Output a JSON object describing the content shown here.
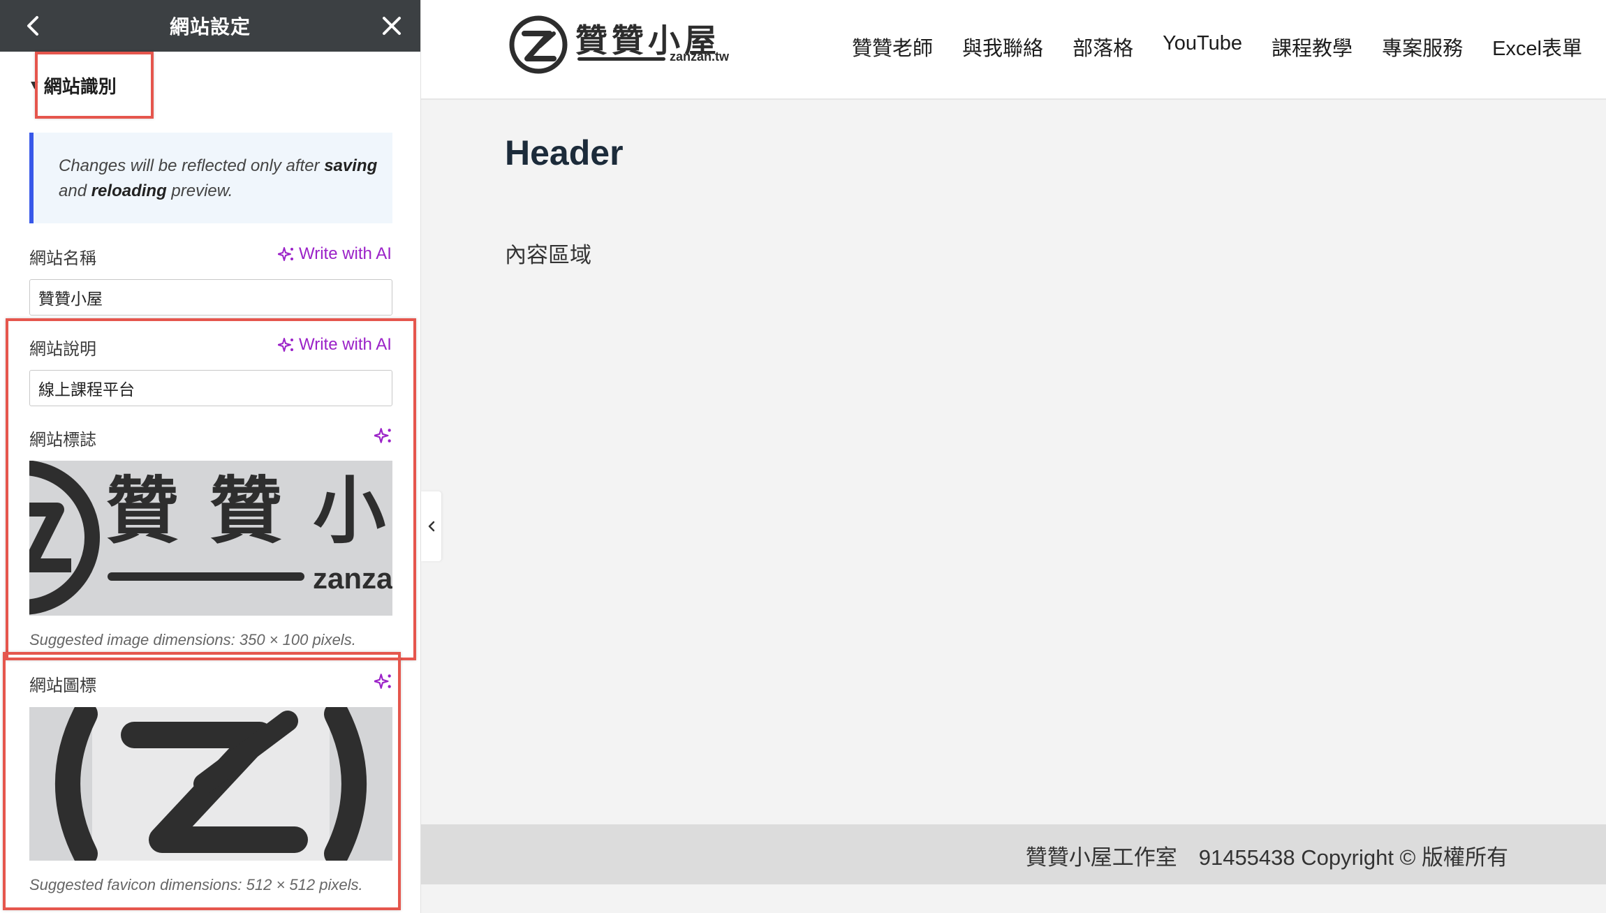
{
  "panel": {
    "title": "網站設定",
    "section_label": "網站識別",
    "notice": {
      "part1": "Changes will be reflected only after ",
      "bold1": "saving",
      "part2": " and ",
      "bold2": "reloading",
      "part3": " preview."
    },
    "ai_label": "Write with AI",
    "fields": {
      "site_title": {
        "label": "網站名稱",
        "value": "贊贊小屋"
      },
      "tagline": {
        "label": "網站說明",
        "value": "線上課程平台"
      },
      "logo": {
        "label": "網站標誌",
        "preview_title": "贊 贊 小 屋",
        "preview_sub": "zanza",
        "help": "Suggested image dimensions: 350 × 100 pixels."
      },
      "icon": {
        "label": "網站圖標",
        "help": "Suggested favicon dimensions: 512 × 512 pixels."
      }
    },
    "icons": {
      "back": "chevron-left-icon",
      "close": "close-icon",
      "caret": "caret-down-icon",
      "ai": "sparkle-icon"
    }
  },
  "preview": {
    "logo": {
      "title": "贊贊小屋",
      "subtitle": "zanzan.tw"
    },
    "nav": [
      "贊贊老師",
      "與我聯絡",
      "部落格",
      "YouTube",
      "課程教學",
      "專案服務",
      "Excel表單"
    ],
    "heading": "Header",
    "content": "內容區域",
    "footer": "贊贊小屋工作室　91455438 Copyright © 版權所有"
  },
  "colors": {
    "panel_header": "#3c4043",
    "ai_accent": "#9b22c8",
    "notice_border": "#3858e9",
    "highlight": "#e5564d"
  }
}
